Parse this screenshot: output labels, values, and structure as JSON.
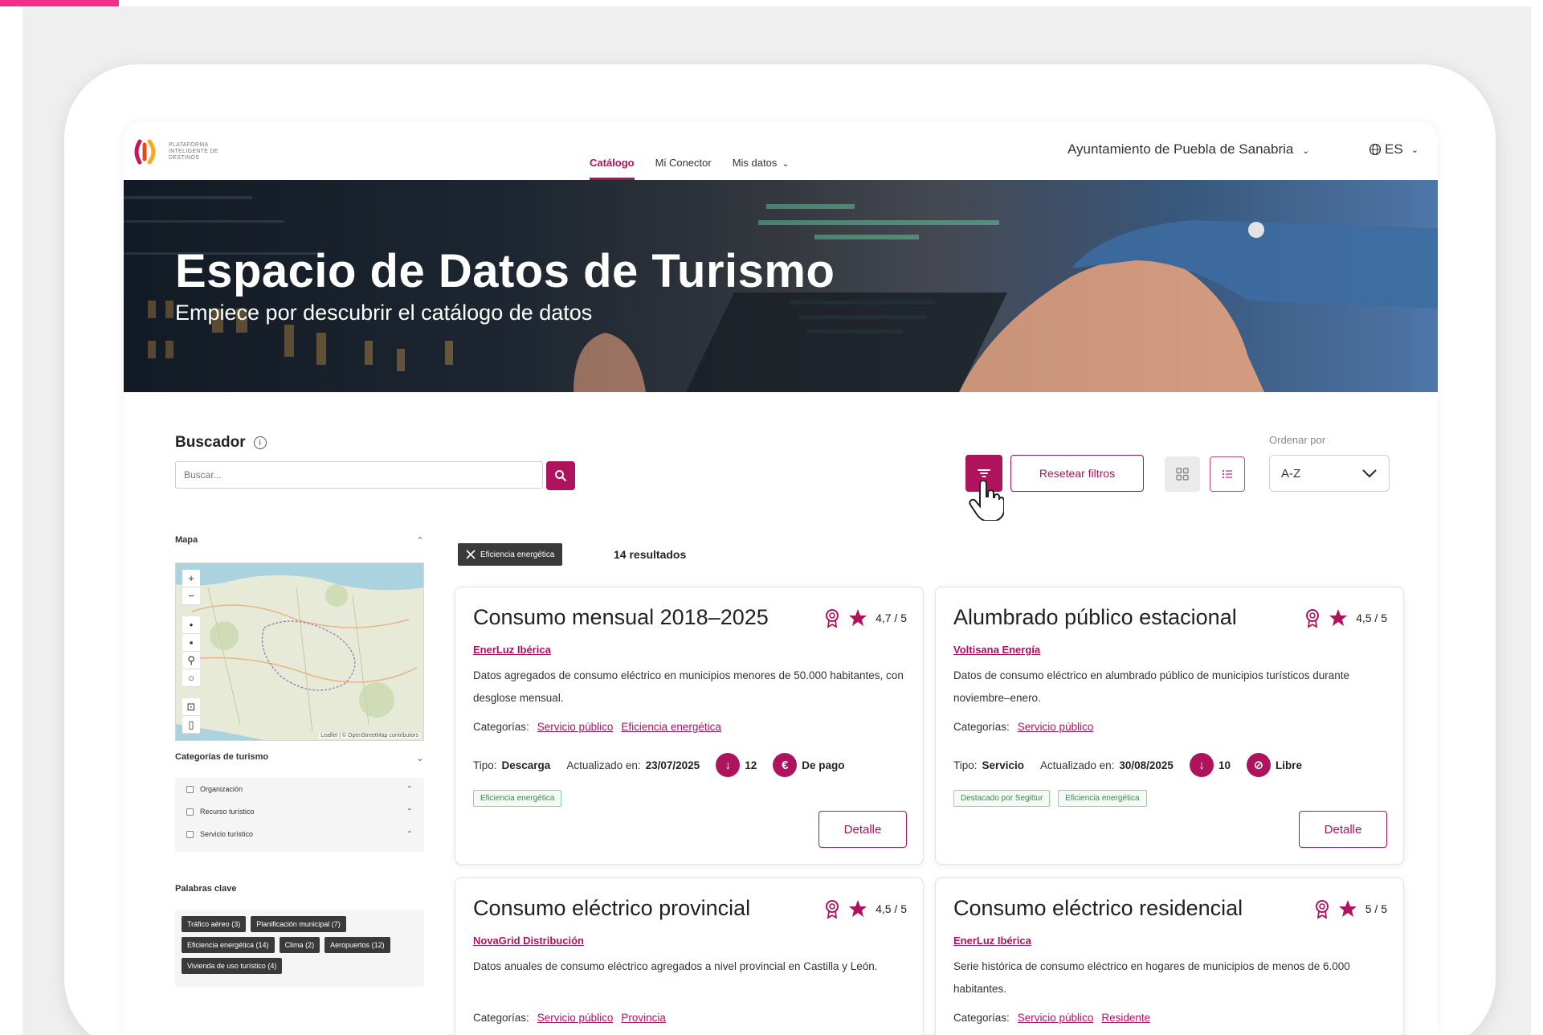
{
  "brand": {
    "logo_text": "PLATAFORMA INTELIGENTE DE DESTINOS",
    "accent": "#b0135e",
    "highlight": "#f0308a"
  },
  "nav": {
    "items": [
      {
        "label": "Catálogo",
        "active": true
      },
      {
        "label": "Mi Conector",
        "active": false
      },
      {
        "label": "Mis datos",
        "active": false
      }
    ],
    "organization": "Ayuntamiento de Puebla de Sanabria",
    "language": "ES"
  },
  "hero": {
    "title": "Espacio de Datos de Turismo",
    "subtitle": "Empiece por descubrir el catálogo de datos"
  },
  "search": {
    "label": "Buscador",
    "placeholder": "Buscar...",
    "reset_label": "Resetear filtros",
    "sort_label": "Ordenar por",
    "sort_value": "A-Z"
  },
  "sidebar": {
    "map_title": "Mapa",
    "map_attribution": "Leaflet | © OpenStreetMap contributors",
    "categories_title": "Categorías de turismo",
    "categories": [
      "Organización",
      "Recurso turístico",
      "Servicio turístico"
    ],
    "keywords_title": "Palabras clave",
    "keywords": [
      "Tráfico aéreo (3)",
      "Planificación municipal (7)",
      "Eficiencia energética (14)",
      "Clima (2)",
      "Aeropuertos (12)",
      "Vivienda de uso turístico (4)"
    ]
  },
  "results": {
    "active_filter": "Eficiencia energética",
    "count_label": "14 resultados",
    "labels": {
      "categories": "Categorías:",
      "type": "Tipo:",
      "updated": "Actualizado en:",
      "detail": "Detalle"
    },
    "cards": [
      {
        "title": "Consumo mensual 2018–2025",
        "rating": "4,7 / 5",
        "provider": "EnerLuz Ibérica",
        "description": "Datos agregados de consumo eléctrico en municipios menores de 50.000 habitantes, con desglose mensual.",
        "categories": [
          "Servicio público",
          "Eficiencia energética"
        ],
        "type": "Descarga",
        "updated": "23/07/2025",
        "downloads": "12",
        "price": "De pago",
        "tags": [
          "Eficiencia energética"
        ]
      },
      {
        "title": "Alumbrado público estacional",
        "rating": "4,5 / 5",
        "provider": "Voltisana Energía",
        "description": "Datos de consumo eléctrico en alumbrado público de municipios turísticos durante noviembre–enero.",
        "categories": [
          "Servicio público"
        ],
        "type": "Servicio",
        "updated": "30/08/2025",
        "downloads": "10",
        "price": "Libre",
        "tags": [
          "Destacado por Segittur",
          "Eficiencia energética"
        ]
      },
      {
        "title": "Consumo eléctrico provincial",
        "rating": "4,5 / 5",
        "provider": "NovaGrid Distribución",
        "description": "Datos anuales de consumo eléctrico agregados a nivel provincial en Castilla y León.",
        "categories": [
          "Servicio público",
          "Provincia"
        ]
      },
      {
        "title": "Consumo eléctrico residencial",
        "rating": "5 / 5",
        "provider": "EnerLuz Ibérica",
        "description": "Serie histórica de consumo eléctrico en hogares de municipios de menos de 6.000 habitantes.",
        "categories": [
          "Servicio público",
          "Residente"
        ]
      }
    ]
  }
}
